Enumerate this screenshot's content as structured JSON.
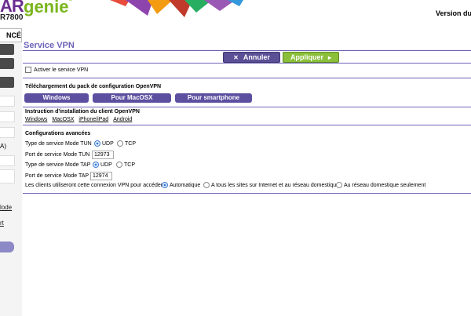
{
  "header": {
    "logo_prefix": "AR",
    "logo_brand": "genie",
    "logo_reg": "®",
    "model": "R7800",
    "version_text": "Version du m"
  },
  "leftnav": {
    "tab": "NCÉ",
    "item_a": "A)",
    "link_mode": "lode",
    "link_rt": "rt"
  },
  "page": {
    "title": "Service VPN",
    "cancel_label": "Annuler",
    "apply_label": "Appliquer",
    "enable_vpn_label": "Activer le service VPN"
  },
  "download": {
    "heading": "Téléchargement du pack de configuration OpenVPN",
    "buttons": [
      "Windows",
      "Pour MacOSX",
      "Pour smartphone"
    ]
  },
  "install": {
    "heading": "Instruction d'installation du client OpenVPN",
    "links": [
      "Windows",
      "MacOSX",
      "iPhone/iPad",
      "Android"
    ]
  },
  "advanced": {
    "heading": "Configurations avancées",
    "tun_type_label": "Type de service Mode TUN",
    "tun_port_label": "Port de service Mode TUN",
    "tun_port_value": "12973",
    "tap_type_label": "Type de service Mode TAP",
    "tap_port_label": "Port de service Mode TAP",
    "tap_port_value": "12974",
    "udp_label": "UDP",
    "tcp_label": "TCP",
    "access_label": "Les clients utiliseront cette connexion VPN pour accéder",
    "access_auto": "Automatique",
    "access_all": "A tous les sites sur Internet et au réseau domestique",
    "access_home": "Au réseau domestique seulement"
  },
  "colors": {
    "accent": "#6c63b8",
    "cancel": "#5b4f95",
    "apply": "#8bbf3a"
  }
}
